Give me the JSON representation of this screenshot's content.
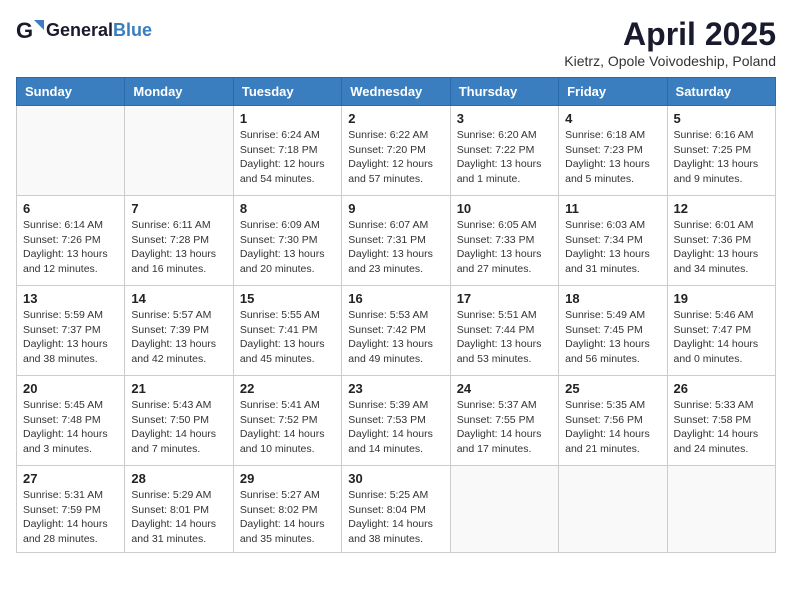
{
  "header": {
    "logo_general": "General",
    "logo_blue": "Blue",
    "month_title": "April 2025",
    "location": "Kietrz, Opole Voivodeship, Poland"
  },
  "days_of_week": [
    "Sunday",
    "Monday",
    "Tuesday",
    "Wednesday",
    "Thursday",
    "Friday",
    "Saturday"
  ],
  "weeks": [
    [
      {
        "day": "",
        "info": ""
      },
      {
        "day": "",
        "info": ""
      },
      {
        "day": "1",
        "info": "Sunrise: 6:24 AM\nSunset: 7:18 PM\nDaylight: 12 hours and 54 minutes."
      },
      {
        "day": "2",
        "info": "Sunrise: 6:22 AM\nSunset: 7:20 PM\nDaylight: 12 hours and 57 minutes."
      },
      {
        "day": "3",
        "info": "Sunrise: 6:20 AM\nSunset: 7:22 PM\nDaylight: 13 hours and 1 minute."
      },
      {
        "day": "4",
        "info": "Sunrise: 6:18 AM\nSunset: 7:23 PM\nDaylight: 13 hours and 5 minutes."
      },
      {
        "day": "5",
        "info": "Sunrise: 6:16 AM\nSunset: 7:25 PM\nDaylight: 13 hours and 9 minutes."
      }
    ],
    [
      {
        "day": "6",
        "info": "Sunrise: 6:14 AM\nSunset: 7:26 PM\nDaylight: 13 hours and 12 minutes."
      },
      {
        "day": "7",
        "info": "Sunrise: 6:11 AM\nSunset: 7:28 PM\nDaylight: 13 hours and 16 minutes."
      },
      {
        "day": "8",
        "info": "Sunrise: 6:09 AM\nSunset: 7:30 PM\nDaylight: 13 hours and 20 minutes."
      },
      {
        "day": "9",
        "info": "Sunrise: 6:07 AM\nSunset: 7:31 PM\nDaylight: 13 hours and 23 minutes."
      },
      {
        "day": "10",
        "info": "Sunrise: 6:05 AM\nSunset: 7:33 PM\nDaylight: 13 hours and 27 minutes."
      },
      {
        "day": "11",
        "info": "Sunrise: 6:03 AM\nSunset: 7:34 PM\nDaylight: 13 hours and 31 minutes."
      },
      {
        "day": "12",
        "info": "Sunrise: 6:01 AM\nSunset: 7:36 PM\nDaylight: 13 hours and 34 minutes."
      }
    ],
    [
      {
        "day": "13",
        "info": "Sunrise: 5:59 AM\nSunset: 7:37 PM\nDaylight: 13 hours and 38 minutes."
      },
      {
        "day": "14",
        "info": "Sunrise: 5:57 AM\nSunset: 7:39 PM\nDaylight: 13 hours and 42 minutes."
      },
      {
        "day": "15",
        "info": "Sunrise: 5:55 AM\nSunset: 7:41 PM\nDaylight: 13 hours and 45 minutes."
      },
      {
        "day": "16",
        "info": "Sunrise: 5:53 AM\nSunset: 7:42 PM\nDaylight: 13 hours and 49 minutes."
      },
      {
        "day": "17",
        "info": "Sunrise: 5:51 AM\nSunset: 7:44 PM\nDaylight: 13 hours and 53 minutes."
      },
      {
        "day": "18",
        "info": "Sunrise: 5:49 AM\nSunset: 7:45 PM\nDaylight: 13 hours and 56 minutes."
      },
      {
        "day": "19",
        "info": "Sunrise: 5:46 AM\nSunset: 7:47 PM\nDaylight: 14 hours and 0 minutes."
      }
    ],
    [
      {
        "day": "20",
        "info": "Sunrise: 5:45 AM\nSunset: 7:48 PM\nDaylight: 14 hours and 3 minutes."
      },
      {
        "day": "21",
        "info": "Sunrise: 5:43 AM\nSunset: 7:50 PM\nDaylight: 14 hours and 7 minutes."
      },
      {
        "day": "22",
        "info": "Sunrise: 5:41 AM\nSunset: 7:52 PM\nDaylight: 14 hours and 10 minutes."
      },
      {
        "day": "23",
        "info": "Sunrise: 5:39 AM\nSunset: 7:53 PM\nDaylight: 14 hours and 14 minutes."
      },
      {
        "day": "24",
        "info": "Sunrise: 5:37 AM\nSunset: 7:55 PM\nDaylight: 14 hours and 17 minutes."
      },
      {
        "day": "25",
        "info": "Sunrise: 5:35 AM\nSunset: 7:56 PM\nDaylight: 14 hours and 21 minutes."
      },
      {
        "day": "26",
        "info": "Sunrise: 5:33 AM\nSunset: 7:58 PM\nDaylight: 14 hours and 24 minutes."
      }
    ],
    [
      {
        "day": "27",
        "info": "Sunrise: 5:31 AM\nSunset: 7:59 PM\nDaylight: 14 hours and 28 minutes."
      },
      {
        "day": "28",
        "info": "Sunrise: 5:29 AM\nSunset: 8:01 PM\nDaylight: 14 hours and 31 minutes."
      },
      {
        "day": "29",
        "info": "Sunrise: 5:27 AM\nSunset: 8:02 PM\nDaylight: 14 hours and 35 minutes."
      },
      {
        "day": "30",
        "info": "Sunrise: 5:25 AM\nSunset: 8:04 PM\nDaylight: 14 hours and 38 minutes."
      },
      {
        "day": "",
        "info": ""
      },
      {
        "day": "",
        "info": ""
      },
      {
        "day": "",
        "info": ""
      }
    ]
  ]
}
